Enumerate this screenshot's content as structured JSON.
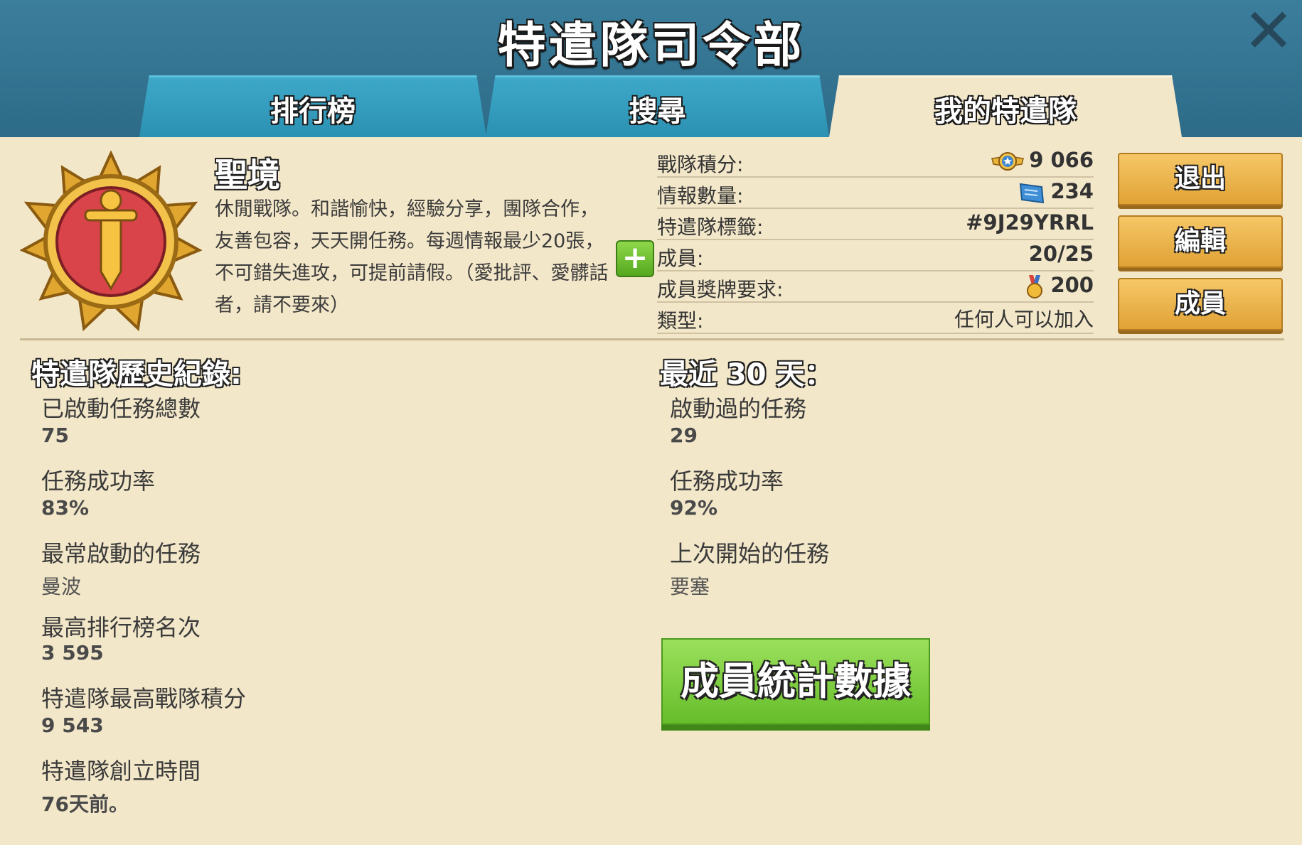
{
  "header": {
    "title": "特遣隊司令部"
  },
  "tabs": [
    {
      "label": "排行榜",
      "active": false
    },
    {
      "label": "搜尋",
      "active": false
    },
    {
      "label": "我的特遣隊",
      "active": true
    }
  ],
  "clan": {
    "name": "聖境",
    "description": "休閒戰隊。和諧愉快，經驗分享，團隊合作，友善包容，天天開任務。每週情報最少20張，不可錯失進攻，可提前請假。（愛批評、愛髒話者，請不要來）"
  },
  "stats": [
    {
      "label": "戰隊積分:",
      "value": "9 066",
      "icon": "victory-points-icon"
    },
    {
      "label": "情報數量:",
      "value": "234",
      "icon": "intel-icon"
    },
    {
      "label": "特遣隊標籤:",
      "value": "#9J29YRRL",
      "icon": ""
    },
    {
      "label": "成員:",
      "value": "20/25",
      "icon": ""
    },
    {
      "label": "成員獎牌要求:",
      "value": "200",
      "icon": "medal-icon"
    },
    {
      "label": "類型:",
      "value": "任何人可以加入",
      "icon": ""
    }
  ],
  "actions": {
    "leave": "退出",
    "edit": "編輯",
    "members": "成員"
  },
  "history": {
    "title": "特遣隊歷史紀錄:",
    "items": [
      {
        "label": "已啟動任務總數",
        "value": "75"
      },
      {
        "label": "任務成功率",
        "value": "83%"
      },
      {
        "label": "最常啟動的任務",
        "value": "曼波"
      },
      {
        "label": "最高排行榜名次",
        "value": "3 595"
      },
      {
        "label": "特遣隊最高戰隊積分",
        "value": "9 543"
      },
      {
        "label": "特遣隊創立時間",
        "value": "76天前。"
      }
    ]
  },
  "recent": {
    "title": "最近 30 天：",
    "items": [
      {
        "label": "啟動過的任務",
        "value": "29"
      },
      {
        "label": "任務成功率",
        "value": "92%"
      },
      {
        "label": "上次開始的任務",
        "value": "要塞"
      }
    ]
  },
  "member_stats_button": "成員統計數據"
}
